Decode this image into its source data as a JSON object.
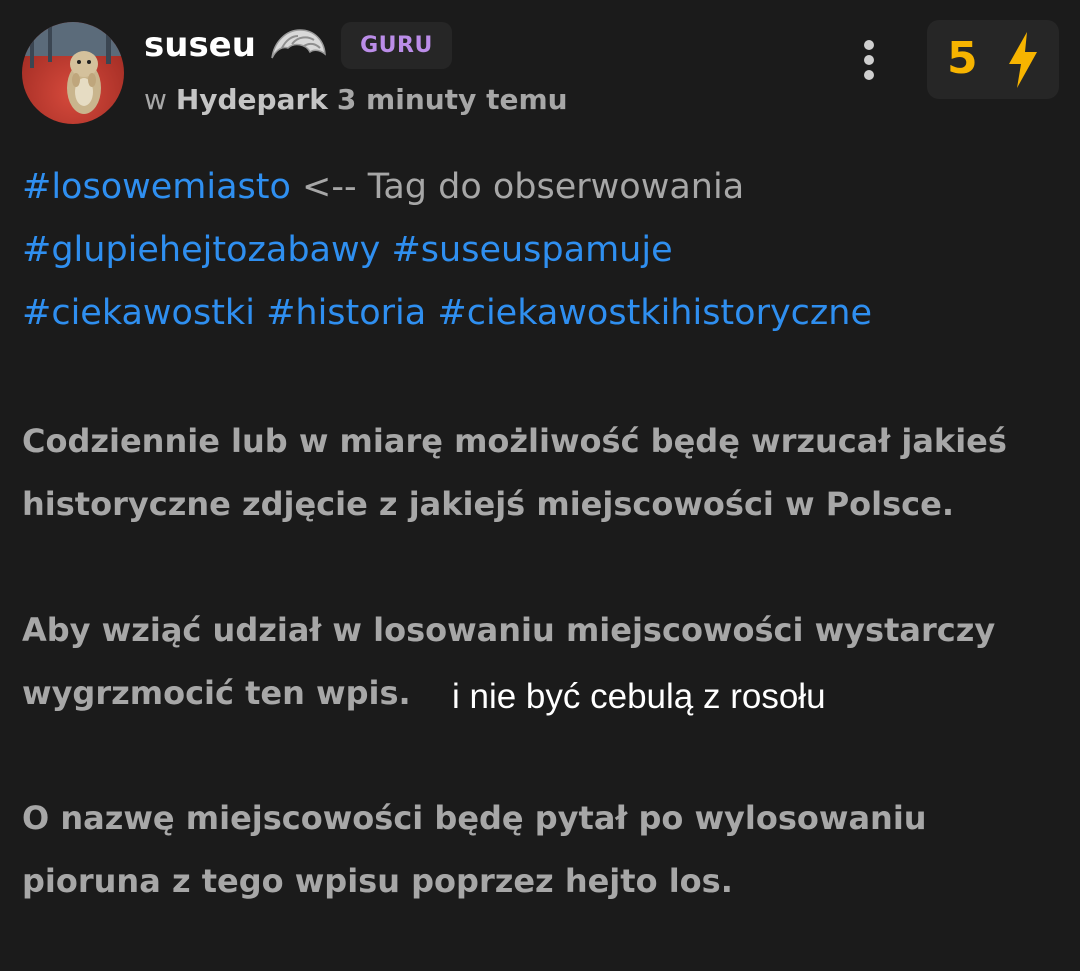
{
  "post": {
    "author": {
      "username": "suseu",
      "badge_icon": "croissant-icon",
      "rank_label": "GURU"
    },
    "meta": {
      "prefix": "w",
      "community": "Hydepark",
      "time": "3 minuty temu"
    },
    "votes": {
      "count": "5",
      "icon": "lightning-icon",
      "color": "#f7b400"
    },
    "tags_block": {
      "line1": [
        {
          "text": "#losowemiasto",
          "is_tag": true
        },
        {
          "text": " <-- Tag do obserwowania",
          "is_tag": false
        }
      ],
      "line2": [
        "#glupiehejtozabawy",
        "#suseuspamuje"
      ],
      "line3": [
        "#ciekawostki",
        "#historia",
        "#ciekawostkihistoryczne"
      ]
    },
    "paragraphs": [
      "Codziennie lub w miarę możliwość będę wrzucał jakieś historyczne zdjęcie z jakiejś miejscowości w Polsce.",
      "Aby wziąć udział w losowaniu miejscowości wystarczy wygrzmocić ten wpis.",
      "O nazwę miejscowości będę pytał po wylosowaniu pioruna z tego wpisu poprzez hejto los."
    ],
    "overlay_text": "i nie być cebulą z rosołu"
  },
  "colors": {
    "background": "#1b1b1b",
    "tag": "#2f8ff0",
    "text_muted": "#a7a7a7",
    "guru": "#bb8de8"
  }
}
